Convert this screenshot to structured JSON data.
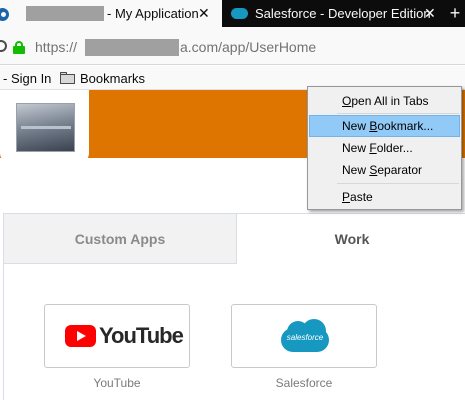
{
  "tabs": [
    {
      "title": "- My Application",
      "close": "✕"
    },
    {
      "title": "Salesforce - Developer Edition",
      "close": "✕"
    }
  ],
  "new_tab": "+",
  "url": {
    "prefix": "https://",
    "suffix": "a.com/app/UserHome"
  },
  "bookmarks_toolbar": {
    "signin": "- Sign In",
    "folder": "Bookmarks"
  },
  "app_tabs": [
    {
      "label": "Custom Apps"
    },
    {
      "label": "Work"
    }
  ],
  "tiles": [
    {
      "caption": "YouTube",
      "logo_text": "YouTube"
    },
    {
      "caption": "Salesforce",
      "logo_text": "salesforce"
    }
  ],
  "context_menu": {
    "items": [
      {
        "pre": "",
        "ul": "O",
        "post": "pen All in Tabs"
      },
      {
        "pre": "New ",
        "ul": "B",
        "post": "ookmark..."
      },
      {
        "pre": "New ",
        "ul": "F",
        "post": "older..."
      },
      {
        "pre": "New ",
        "ul": "S",
        "post": "eparator"
      },
      {
        "pre": "",
        "ul": "P",
        "post": "aste"
      }
    ],
    "highlighted_index": 1
  },
  "colors": {
    "banner": "#de7500",
    "highlight": "#91c9f7",
    "youtube_red": "#ff0000",
    "salesforce_blue": "#1798c1",
    "lock_green": "#12bc00"
  }
}
